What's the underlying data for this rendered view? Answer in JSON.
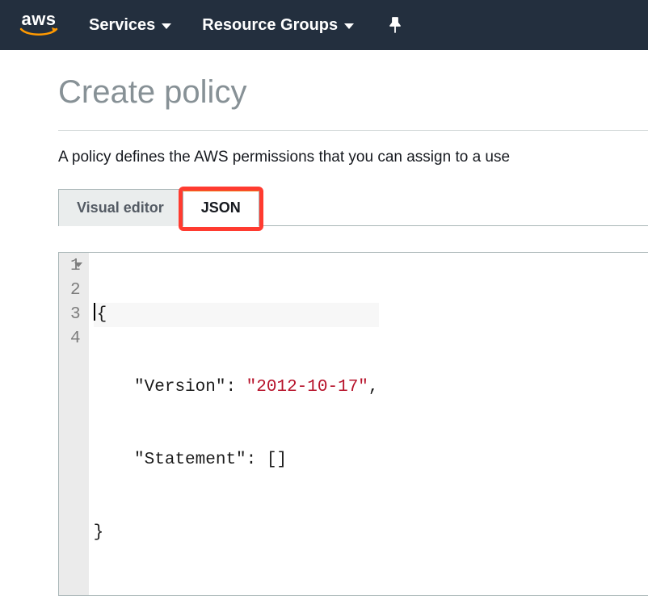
{
  "nav": {
    "logo_text": "aws",
    "services_label": "Services",
    "resource_groups_label": "Resource Groups"
  },
  "page": {
    "title": "Create policy",
    "description": "A policy defines the AWS permissions that you can assign to a use"
  },
  "tabs": {
    "visual_editor": "Visual editor",
    "json": "JSON"
  },
  "editor": {
    "line_numbers": [
      "1",
      "2",
      "3",
      "4"
    ],
    "l1": "{",
    "l2_key": "\"Version\"",
    "l2_sep": ": ",
    "l2_val": "\"2012-10-17\"",
    "l2_end": ",",
    "l3_key": "\"Statement\"",
    "l3_rest": ": []",
    "l4": "}"
  }
}
